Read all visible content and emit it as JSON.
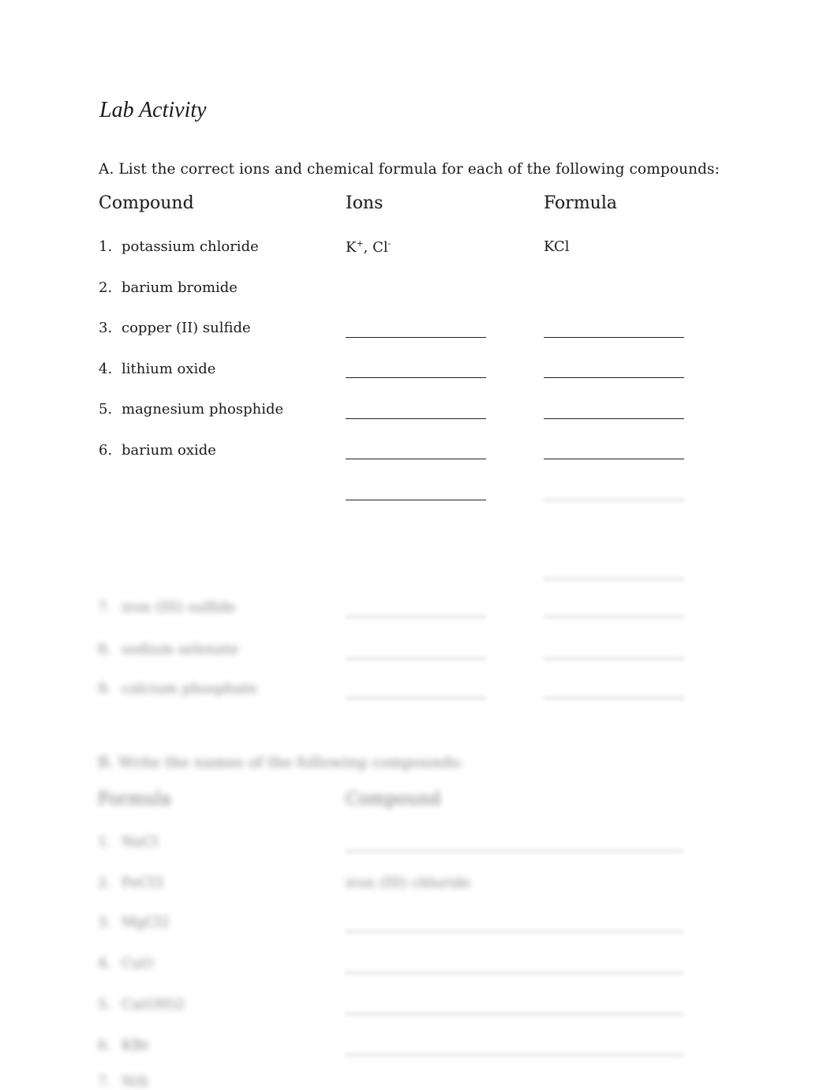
{
  "title": "Lab Activity",
  "section_a": {
    "instruction": "A.  List the correct ions and chemical formula for each of the following compounds:",
    "headers": {
      "compound": "Compound",
      "ions": "Ions",
      "formula": "Formula"
    },
    "rows": [
      {
        "num": "1.",
        "compound": "potassium chloride",
        "ions_base1": "K",
        "ions_sup1": "+",
        "ions_sep": ", Cl",
        "ions_sup2": "-",
        "formula": "KCl"
      },
      {
        "num": "2.",
        "compound": "barium bromide"
      },
      {
        "num": "3.",
        "compound": "copper (II) sulfide"
      },
      {
        "num": "4.",
        "compound": "lithium oxide"
      },
      {
        "num": "5.",
        "compound": "magnesium phosphide"
      },
      {
        "num": "6.",
        "compound": "barium oxide"
      }
    ],
    "blurred_rows": [
      {
        "num": "7.",
        "compound": "iron (III) sulfide"
      },
      {
        "num": "8.",
        "compound": "sodium selenate"
      },
      {
        "num": "9.",
        "compound": "calcium phosphate"
      }
    ]
  },
  "section_b": {
    "instruction": "B.  Write the names of the following compounds:",
    "headers": {
      "formula": "Formula",
      "compound": "Compound"
    },
    "rows": [
      {
        "num": "1.",
        "formula": "NaCl",
        "answer": ""
      },
      {
        "num": "2.",
        "formula": "FeCl3",
        "answer": "iron (III) chloride"
      },
      {
        "num": "3.",
        "formula": "MgCl2",
        "answer": ""
      },
      {
        "num": "4.",
        "formula": "CuO",
        "answer": ""
      },
      {
        "num": "5.",
        "formula": "Ca(OH)2",
        "answer": ""
      },
      {
        "num": "6.",
        "formula": "KBr",
        "answer": ""
      },
      {
        "num": "7.",
        "formula": "NiS",
        "answer": ""
      }
    ]
  }
}
